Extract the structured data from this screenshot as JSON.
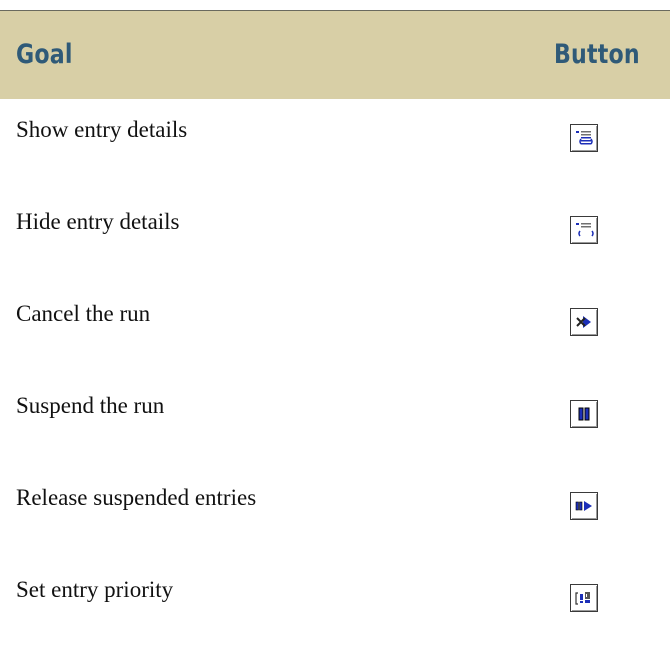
{
  "table": {
    "header": {
      "goal": "Goal",
      "button": "Button"
    },
    "rows": [
      {
        "goal": "Show entry details",
        "icon": "show-details-icon"
      },
      {
        "goal": "Hide entry details",
        "icon": "hide-details-icon"
      },
      {
        "goal": "Cancel the run",
        "icon": "cancel-run-icon"
      },
      {
        "goal": "Suspend the run",
        "icon": "suspend-run-icon"
      },
      {
        "goal": "Release suspended entries",
        "icon": "release-entries-icon"
      },
      {
        "goal": "Set entry priority",
        "icon": "set-priority-icon"
      }
    ]
  },
  "colors": {
    "header_bg": "#d8cfa6",
    "header_text": "#2f5a78",
    "icon_blue": "#1c2fb8"
  }
}
